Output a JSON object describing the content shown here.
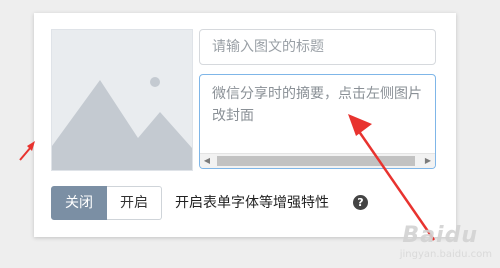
{
  "editor": {
    "title_placeholder": "请输入图文的标题",
    "summary_placeholder": "微信分享时的摘要，点击左侧图片改封面",
    "cover_icon": "image-placeholder-icon"
  },
  "toggle": {
    "off_label": "关闭",
    "on_label": "开启",
    "selected": "关闭"
  },
  "feature": {
    "label": "开启表单字体等增强特性",
    "help_icon": "question-circle-icon",
    "help_glyph": "?"
  },
  "watermark": {
    "brand": "Baidu",
    "sub": "jingyan.baidu.com"
  },
  "colors": {
    "annotation_arrow": "#e8332f",
    "toggle_active": "#7b8fa4",
    "focus_border": "#7fb6e8"
  }
}
